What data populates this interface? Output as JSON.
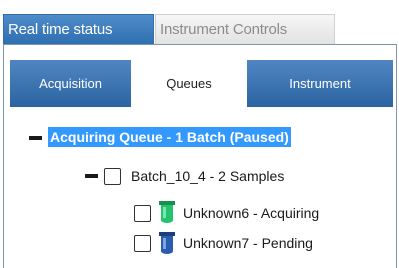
{
  "outer_tabs": [
    {
      "label": "Real time status",
      "active": true
    },
    {
      "label": "Instrument Controls",
      "active": false
    }
  ],
  "inner_tabs": [
    {
      "label": "Acquisition",
      "style": "blue"
    },
    {
      "label": "Queues",
      "style": "white"
    },
    {
      "label": "Instrument",
      "style": "blue"
    }
  ],
  "tree": {
    "queue": {
      "label": "Acquiring Queue - 1 Batch (Paused)",
      "expanded": true,
      "selected": true
    },
    "batch": {
      "label": "Batch_10_4 - 2 Samples",
      "expanded": true
    },
    "samples": [
      {
        "label": "Unknown6 - Acquiring",
        "icon": "vial-acquiring-icon",
        "color": "#22c46e"
      },
      {
        "label": "Unknown7 - Pending",
        "icon": "vial-pending-icon",
        "color": "#2a5db0"
      }
    ]
  },
  "colors": {
    "tab_active": "#2f6fb0",
    "selection": "#3399ff",
    "acquiring": "#22c46e",
    "pending": "#2a5db0"
  }
}
